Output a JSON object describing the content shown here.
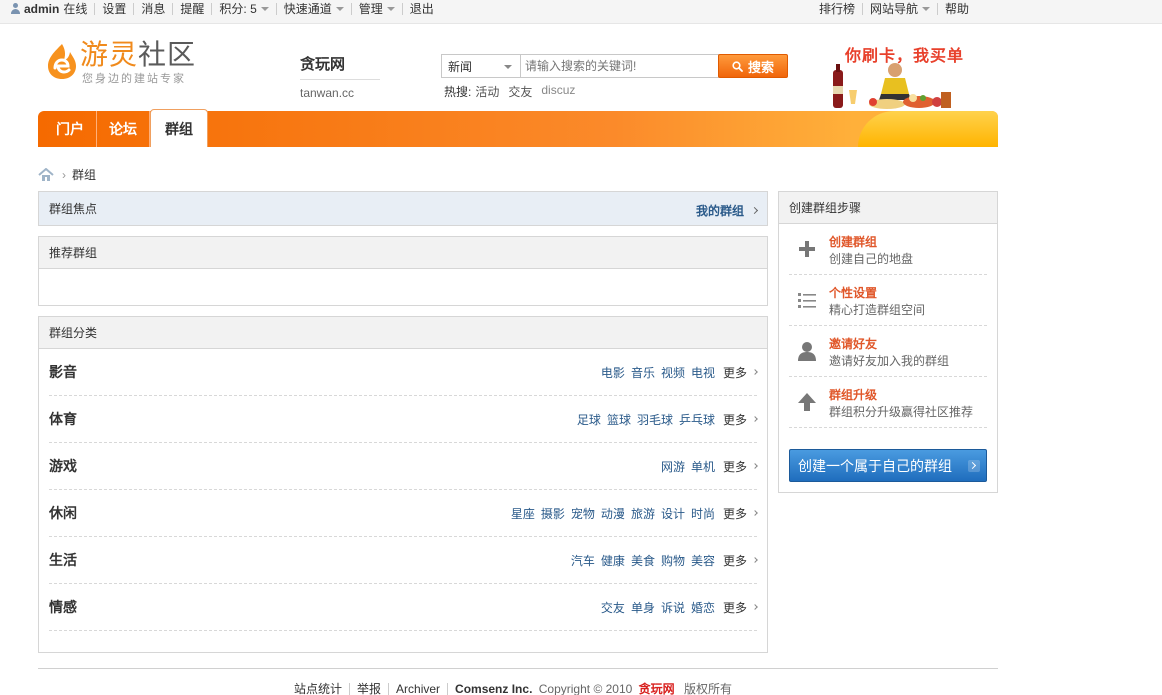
{
  "topbar": {
    "username": "admin",
    "online": "在线",
    "settings": "设置",
    "messages": "消息",
    "reminders": "提醒",
    "points": "积分: 5",
    "quick_access": "快速通道",
    "manage": "管理",
    "logout": "退出",
    "ranking": "排行榜",
    "site_nav": "网站导航",
    "help": "帮助"
  },
  "logo": {
    "title_left": "游灵",
    "title_right": "社区",
    "slogan": "您身边的建站专家"
  },
  "site": {
    "name": "贪玩网",
    "domain": "tanwan.cc"
  },
  "search": {
    "category": "新闻",
    "placeholder": "请输入搜索的关键词!",
    "button": "搜索",
    "hot_label": "热搜:",
    "hot_links": [
      "活动",
      "交友",
      "discuz"
    ]
  },
  "ad": {
    "slogan": "你刷卡，我买单"
  },
  "nav": {
    "items": [
      "门户",
      "论坛",
      "群组"
    ],
    "active": "群组"
  },
  "breadcrumb": {
    "current": "群组"
  },
  "focus": {
    "title": "群组焦点",
    "my_groups": "我的群组"
  },
  "recommended": {
    "title": "推荐群组"
  },
  "categories": {
    "title": "群组分类",
    "more": "更多",
    "rows": [
      {
        "name": "影音",
        "links": [
          "电影",
          "音乐",
          "视频",
          "电视"
        ]
      },
      {
        "name": "体育",
        "links": [
          "足球",
          "篮球",
          "羽毛球",
          "乒乓球"
        ]
      },
      {
        "name": "游戏",
        "links": [
          "网游",
          "单机"
        ]
      },
      {
        "name": "休闲",
        "links": [
          "星座",
          "摄影",
          "宠物",
          "动漫",
          "旅游",
          "设计",
          "时尚"
        ]
      },
      {
        "name": "生活",
        "links": [
          "汽车",
          "健康",
          "美食",
          "购物",
          "美容"
        ]
      },
      {
        "name": "情感",
        "links": [
          "交友",
          "单身",
          "诉说",
          "婚恋"
        ]
      }
    ]
  },
  "steps": {
    "title": "创建群组步骤",
    "items": [
      {
        "title": "创建群组",
        "desc": "创建自己的地盘",
        "icon": "plus-icon"
      },
      {
        "title": "个性设置",
        "desc": "精心打造群组空间",
        "icon": "list-icon"
      },
      {
        "title": "邀请好友",
        "desc": "邀请好友加入我的群组",
        "icon": "person-icon"
      },
      {
        "title": "群组升级",
        "desc": "群组积分升级赢得社区推荐",
        "icon": "up-arrow-icon"
      }
    ],
    "create_button": "创建一个属于自己的群组"
  },
  "footer": {
    "stats": "站点统计",
    "report": "举报",
    "archiver": "Archiver",
    "company": "Comsenz Inc.",
    "copyright": "Copyright © 2010",
    "brand": "贪玩网",
    "rights": "版权所有"
  },
  "colors": {
    "nav_orange": "#f56a00",
    "link_blue": "#2a5a8a",
    "step_title": "#e0572a",
    "create_button": "#1f6dbd"
  }
}
